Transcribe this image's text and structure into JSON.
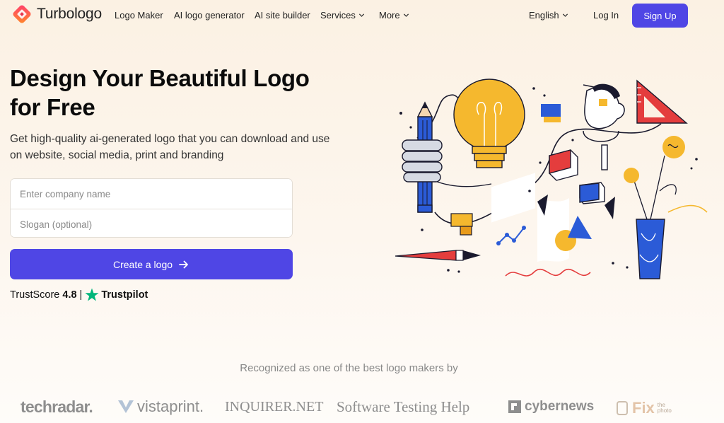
{
  "header": {
    "logo_text": "Turbologo",
    "nav": [
      {
        "label": "Logo Maker"
      },
      {
        "label": "AI logo generator"
      },
      {
        "label": "AI site builder"
      },
      {
        "label": "Services"
      },
      {
        "label": "More"
      }
    ],
    "language": "English",
    "login": "Log In",
    "signup": "Sign Up"
  },
  "hero": {
    "title_line1": "Design Your Beautiful Logo",
    "title_line2": "for Free",
    "subtitle_line1": "Get high-quality ai-generated logo that you can download and use",
    "subtitle_line2": "on website, social media, print and branding",
    "company_placeholder": "Enter company name",
    "slogan_placeholder": "Slogan (optional)",
    "cta": "Create a logo",
    "trust_label": "TrustScore",
    "trust_score": "4.8",
    "trust_sep": "|",
    "trust_brand": "Trustpilot"
  },
  "recognized": {
    "text": "Recognized as one of the best logo makers by",
    "brands": [
      {
        "name": "techradar."
      },
      {
        "name": "vistaprint."
      },
      {
        "name": "INQUIRER.NET"
      },
      {
        "name": "Software Testing Help"
      },
      {
        "name": "cybernews"
      },
      {
        "name": "Fix",
        "suffix": "the photo"
      }
    ]
  },
  "colors": {
    "accent": "#4f46e5",
    "trustpilot_green": "#00b67a",
    "background": "#fbf1e3",
    "illustration_blue": "#2b5bd7",
    "illustration_yellow": "#f5b82e",
    "illustration_red": "#e43d3d"
  },
  "icons": {
    "logo": "turbologo-diamond-icon",
    "cta_arrow": "arrow-right-icon",
    "trust_star": "star-icon",
    "dropdown": "chevron-down-icon"
  }
}
